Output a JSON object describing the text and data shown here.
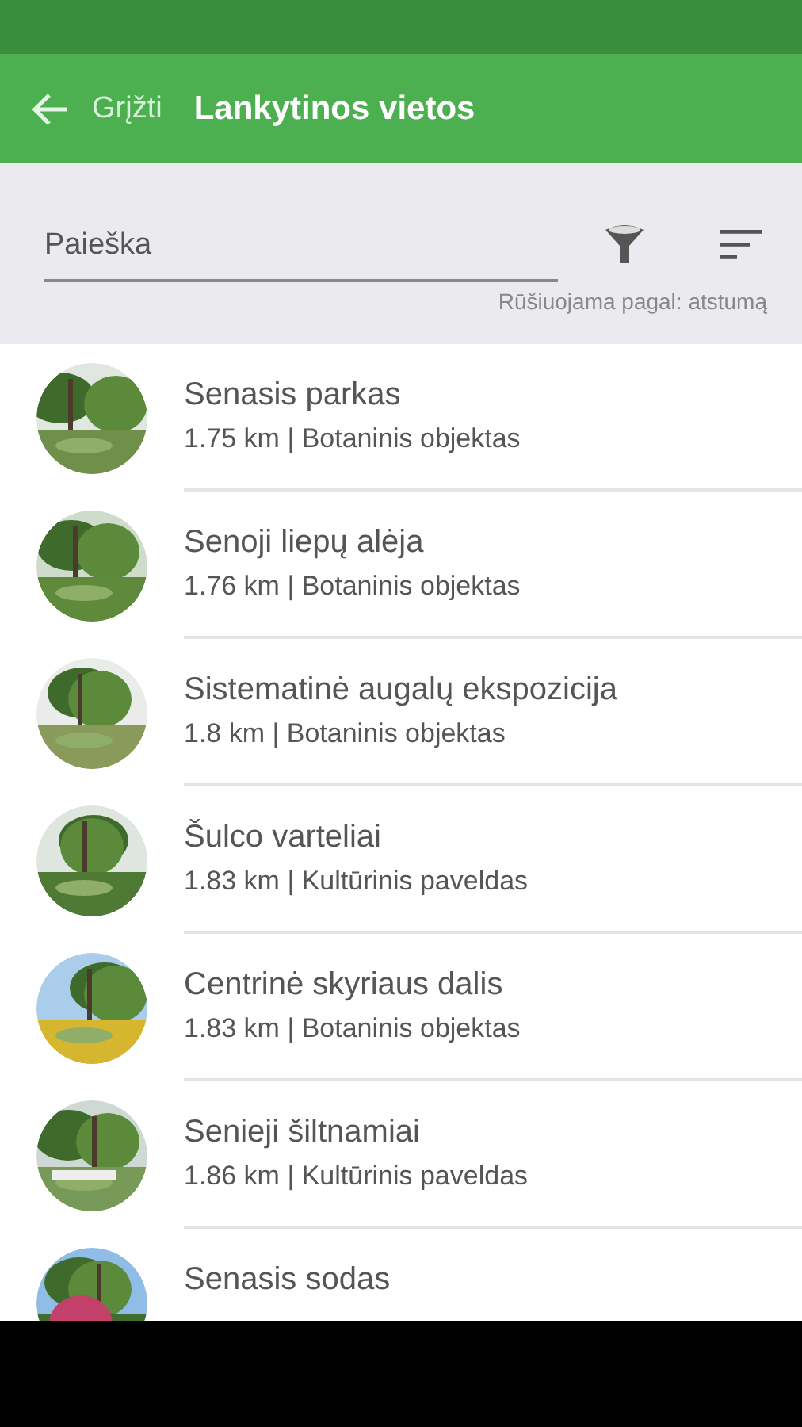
{
  "app_bar": {
    "back_label": "Grįžti",
    "title": "Lankytinos vietos"
  },
  "search": {
    "placeholder": "Paieška",
    "sort_note": "Rūšiuojama pagal: atstumą"
  },
  "places": [
    {
      "title": "Senasis parkas",
      "subtitle": "1.75 km | Botaninis objektas"
    },
    {
      "title": "Senoji liepų alėja",
      "subtitle": "1.76 km | Botaninis objektas"
    },
    {
      "title": "Sistematinė augalų ekspozicija",
      "subtitle": "1.8 km | Botaninis objektas"
    },
    {
      "title": "Šulco varteliai",
      "subtitle": "1.83 km | Kultūrinis paveldas"
    },
    {
      "title": "Centrinė skyriaus dalis",
      "subtitle": "1.83 km | Botaninis objektas"
    },
    {
      "title": "Senieji šiltnamiai",
      "subtitle": "1.86 km | Kultūrinis paveldas"
    },
    {
      "title": "Senasis sodas"
    }
  ]
}
